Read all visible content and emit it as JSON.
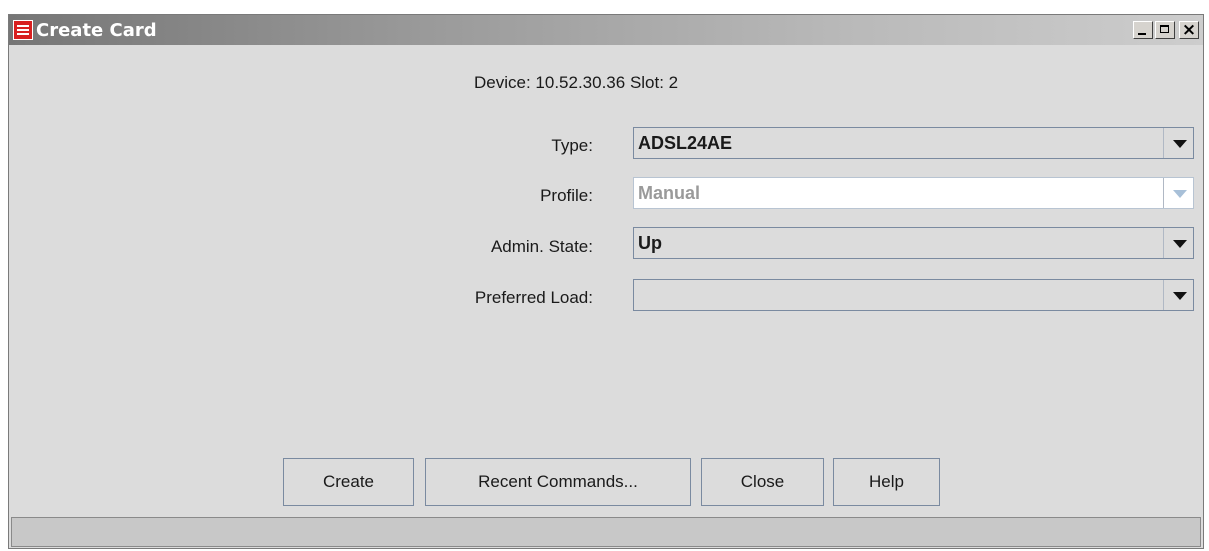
{
  "window": {
    "title": "Create Card",
    "controls": {
      "minimize_icon": "minimize-icon",
      "maximize_icon": "maximize-icon",
      "close_icon": "close-icon",
      "close_glyph": "×"
    }
  },
  "header": {
    "device_info": "Device: 10.52.30.36  Slot: 2"
  },
  "form": {
    "type": {
      "label": "Type:",
      "value": "ADSL24AE"
    },
    "profile": {
      "label": "Profile:",
      "value": "Manual",
      "enabled": false
    },
    "admin_state": {
      "label": "Admin. State:",
      "value": "Up"
    },
    "preferred_load": {
      "label": "Preferred Load:",
      "value": ""
    }
  },
  "buttons": {
    "create": "Create",
    "recent_commands": "Recent Commands...",
    "close": "Close",
    "help": "Help"
  },
  "status": {
    "text": ""
  },
  "colors": {
    "dialog_bg": "#dcdcdc",
    "app_icon": "#d82020",
    "combo_border": "#7a8aa0",
    "disabled_text": "#9a9a9a"
  }
}
